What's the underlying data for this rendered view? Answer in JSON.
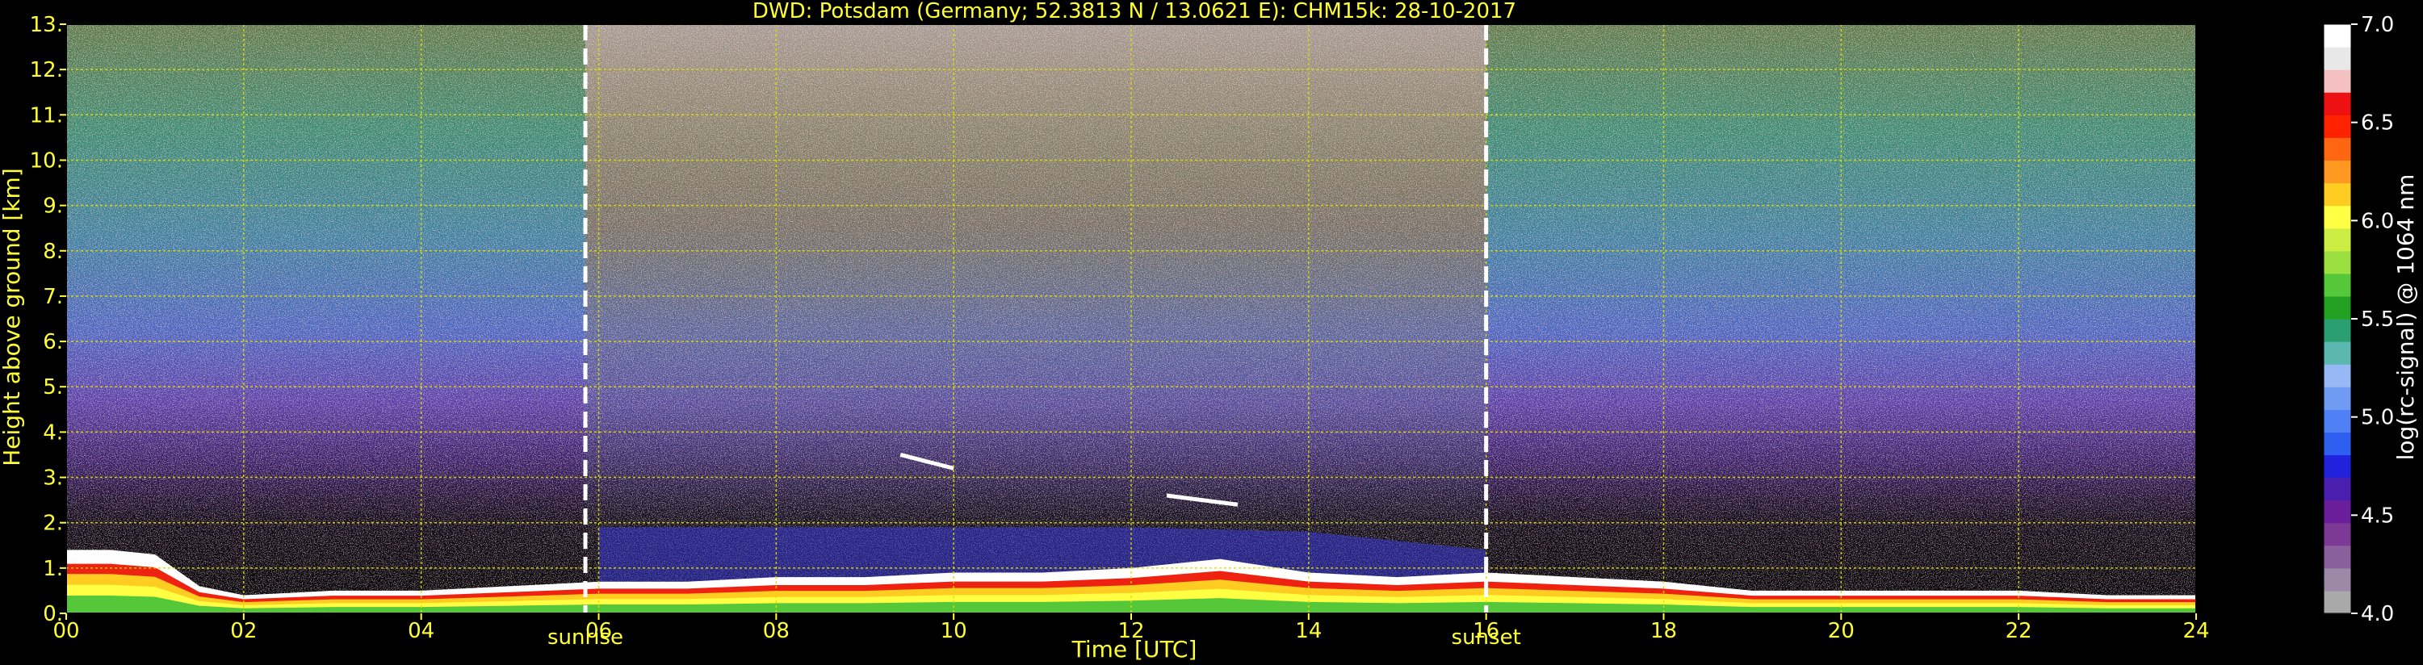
{
  "chart_data": {
    "type": "heatmap",
    "title": "DWD: Potsdam (Germany; 52.3813 N / 13.0621 E):    CHM15k: 28-10-2017",
    "xlabel": "Time [UTC]",
    "ylabel": "Height above ground [km]",
    "xlim": [
      0,
      24
    ],
    "ylim": [
      0,
      13
    ],
    "x_ticks": [
      0,
      2,
      4,
      6,
      8,
      10,
      12,
      14,
      16,
      18,
      20,
      22,
      24
    ],
    "x_tick_labels": [
      "00",
      "02",
      "04",
      "06",
      "08",
      "10",
      "12",
      "14",
      "16",
      "18",
      "20",
      "22",
      "24"
    ],
    "y_ticks": [
      0,
      1,
      2,
      3,
      4,
      5,
      6,
      7,
      8,
      9,
      10,
      11,
      12,
      13
    ],
    "y_tick_labels": [
      "0.",
      "1.",
      "2.",
      "3.",
      "4.",
      "5.",
      "6.",
      "7.",
      "8.",
      "9.",
      "10.",
      "11.",
      "12.",
      "13."
    ],
    "grid": true,
    "markers": [
      {
        "label": "sunrise",
        "time": 5.85
      },
      {
        "label": "sunset",
        "time": 16.0
      }
    ],
    "colorbar": {
      "label": "log(rc-signal) @ 1064 nm",
      "range": [
        4.0,
        7.0
      ],
      "ticks": [
        4.0,
        4.5,
        5.0,
        5.5,
        6.0,
        6.5,
        7.0
      ],
      "tick_labels": [
        "4.0",
        "4.5",
        "5.0",
        "5.5",
        "6.0",
        "6.5",
        "7.0"
      ],
      "colors": [
        "#a9a9a9",
        "#9d88a7",
        "#8b5e9c",
        "#7c3a96",
        "#6a1e99",
        "#4a1fb0",
        "#2222dd",
        "#2f5ff0",
        "#4f80f5",
        "#6f9bf5",
        "#98b8f5",
        "#5ab8b0",
        "#2aa070",
        "#22a022",
        "#55c83a",
        "#99e040",
        "#ccee44",
        "#ffff44",
        "#ffcc22",
        "#ff9922",
        "#ff6611",
        "#ff2200",
        "#ee1111",
        "#f4c0c0",
        "#e8e8e8",
        "#ffffff"
      ]
    },
    "series": [
      {
        "name": "aerosol_layer_top",
        "x": [
          0,
          0.5,
          1,
          1.5,
          2,
          3,
          4,
          5,
          6,
          7,
          8,
          9,
          10,
          11,
          12,
          13,
          14,
          15,
          16,
          17,
          18,
          19,
          20,
          21,
          22,
          23,
          24
        ],
        "y": [
          1.4,
          1.4,
          1.3,
          0.6,
          0.4,
          0.5,
          0.5,
          0.6,
          0.7,
          0.7,
          0.8,
          0.8,
          0.9,
          0.9,
          1.0,
          1.2,
          0.9,
          0.8,
          0.9,
          0.8,
          0.7,
          0.5,
          0.5,
          0.5,
          0.5,
          0.4,
          0.4
        ]
      },
      {
        "name": "elevated_layer_top",
        "x": [
          6,
          8,
          10,
          12,
          14,
          16
        ],
        "y": [
          1.9,
          1.9,
          1.9,
          1.9,
          1.8,
          1.4
        ]
      },
      {
        "name": "cloud_segments",
        "x": [
          [
            9.4,
            10.0
          ],
          [
            12.4,
            13.2
          ]
        ],
        "y": [
          [
            3.5,
            3.2
          ],
          [
            2.6,
            2.4
          ]
        ]
      }
    ]
  }
}
